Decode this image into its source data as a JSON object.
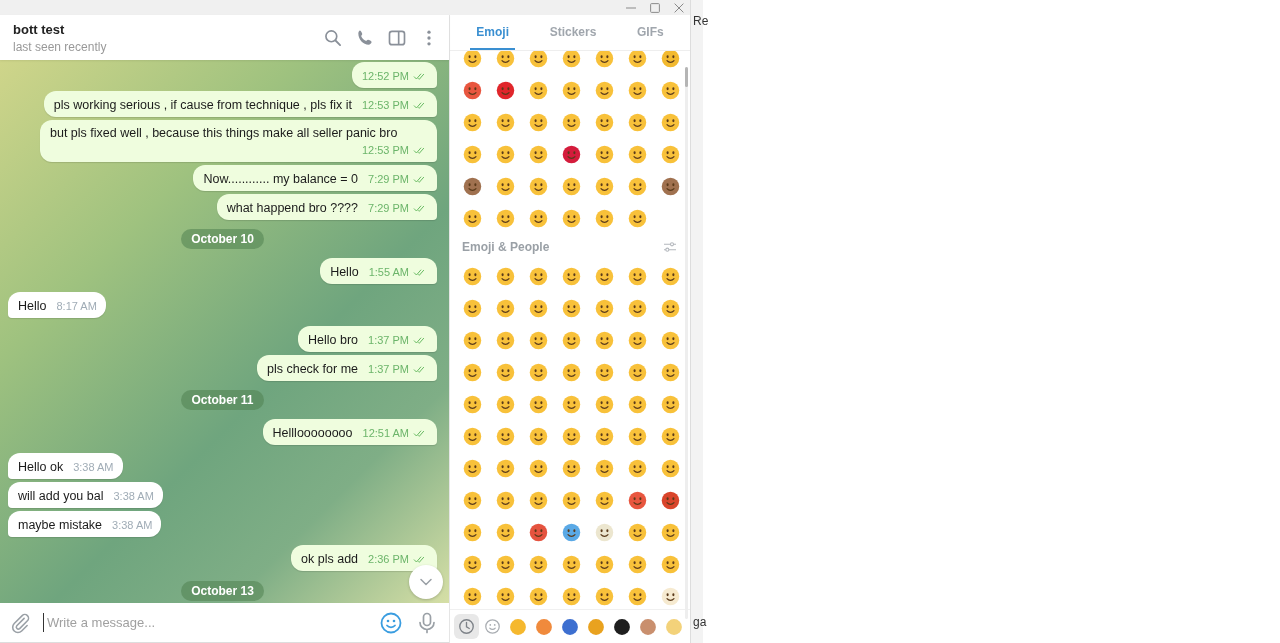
{
  "chat": {
    "title": "bott test",
    "status": "last seen recently"
  },
  "messages": [
    {
      "kind": "message",
      "outgoing": true,
      "read": true,
      "time": "12:52 PM"
    },
    {
      "kind": "message",
      "outgoing": true,
      "read": true,
      "text": "pls working serious ,  if cause from technique  , pls fix it",
      "time": "12:53 PM"
    },
    {
      "kind": "message",
      "outgoing": true,
      "read": true,
      "text": "but pls fixed well , because this things make all seller panic bro",
      "time": "12:53 PM"
    },
    {
      "kind": "message",
      "outgoing": true,
      "read": true,
      "text": "Now............ my balance = 0",
      "time": "7:29 PM"
    },
    {
      "kind": "message",
      "outgoing": true,
      "read": true,
      "text": "what happend bro ????",
      "time": "7:29 PM"
    },
    {
      "kind": "date",
      "text": "October 10"
    },
    {
      "kind": "message",
      "outgoing": true,
      "read": true,
      "text": "Hello",
      "time": "1:55 AM"
    },
    {
      "kind": "message",
      "outgoing": false,
      "text": "Hello",
      "time": "8:17 AM"
    },
    {
      "kind": "message",
      "outgoing": true,
      "read": true,
      "text": "Hello bro",
      "time": "1:37 PM"
    },
    {
      "kind": "message",
      "outgoing": true,
      "read": true,
      "text": "pls check for me",
      "time": "1:37 PM"
    },
    {
      "kind": "date",
      "text": "October 11"
    },
    {
      "kind": "message",
      "outgoing": true,
      "read": true,
      "text": "Hellloooooooo",
      "time": "12:51 AM"
    },
    {
      "kind": "message",
      "outgoing": false,
      "text": "Hello ok",
      "time": "3:38 AM"
    },
    {
      "kind": "message",
      "outgoing": false,
      "text": "will add you bal",
      "time": "3:38 AM"
    },
    {
      "kind": "message",
      "outgoing": false,
      "text": "maybe mistake",
      "time": "3:38 AM"
    },
    {
      "kind": "message",
      "outgoing": true,
      "read": true,
      "text": "ok pls add",
      "time": "2:36 PM"
    },
    {
      "kind": "date",
      "text": "October 13"
    }
  ],
  "compose": {
    "placeholder": "Write a message..."
  },
  "emoji_panel": {
    "tabs": [
      {
        "label": "Emoji",
        "selected": true
      },
      {
        "label": "Stickers",
        "selected": false
      },
      {
        "label": "GIFs",
        "selected": false
      }
    ],
    "sections": [
      {
        "emoji": [
          {
            "color": "#f8c13a"
          },
          {
            "color": "#f8c13a"
          },
          {
            "color": "#f8c13a"
          },
          {
            "color": "#f8c13a"
          },
          {
            "color": "#f8c13a"
          },
          {
            "color": "#f8c13a"
          },
          {
            "color": "#f2b92f"
          },
          {
            "color": "#e8563f"
          },
          {
            "color": "#e0262b"
          },
          {
            "color": "#f8c13a"
          },
          {
            "color": "#f8c13a"
          },
          {
            "color": "#f8c13a"
          },
          {
            "color": "#f8c13a"
          },
          {
            "color": "#f8c13a"
          },
          {
            "color": "#f8c13a"
          },
          {
            "color": "#f8c13a"
          },
          {
            "color": "#f8c13a"
          },
          {
            "color": "#f8c13a"
          },
          {
            "color": "#f8c13a"
          },
          {
            "color": "#f8c13a"
          },
          {
            "color": "#f8c13a"
          },
          {
            "color": "#f8c13a"
          },
          {
            "color": "#f8c13a"
          },
          {
            "color": "#f8c13a"
          },
          {
            "color": "#d41c3c"
          },
          {
            "color": "#f8c13a"
          },
          {
            "color": "#f8c13a"
          },
          {
            "color": "#f8c13a"
          },
          {
            "color": "#a0714f"
          },
          {
            "color": "#f8c13a"
          },
          {
            "color": "#f8c13a"
          },
          {
            "color": "#f8c13a"
          },
          {
            "color": "#f8c13a"
          },
          {
            "color": "#f8c13a"
          },
          {
            "color": "#a0714f"
          },
          {
            "color": "#f8c13a"
          },
          {
            "color": "#f8c13a"
          },
          {
            "color": "#f8c13a"
          },
          {
            "color": "#f8c13a"
          },
          {
            "color": "#f8c13a"
          },
          {
            "color": "#f8c13a"
          }
        ]
      },
      {
        "title": "Emoji & People",
        "emoji": [
          {
            "color": "#f8c13a"
          },
          {
            "color": "#f8c13a"
          },
          {
            "color": "#f8c13a"
          },
          {
            "color": "#f8c13a"
          },
          {
            "color": "#f8c13a"
          },
          {
            "color": "#f8c13a"
          },
          {
            "color": "#f8c13a"
          },
          {
            "color": "#f8c13a"
          },
          {
            "color": "#f8c13a"
          },
          {
            "color": "#f8c13a"
          },
          {
            "color": "#f8c13a"
          },
          {
            "color": "#f8c13a"
          },
          {
            "color": "#f8c13a"
          },
          {
            "color": "#f8c13a"
          },
          {
            "color": "#f8c13a"
          },
          {
            "color": "#f8c13a"
          },
          {
            "color": "#f8c13a"
          },
          {
            "color": "#f8c13a"
          },
          {
            "color": "#f8c13a"
          },
          {
            "color": "#f8c13a"
          },
          {
            "color": "#f8c13a"
          },
          {
            "color": "#f8c13a"
          },
          {
            "color": "#f8c13a"
          },
          {
            "color": "#f8c13a"
          },
          {
            "color": "#f8c13a"
          },
          {
            "color": "#f8c13a"
          },
          {
            "color": "#f8c13a"
          },
          {
            "color": "#f8c13a"
          },
          {
            "color": "#f8c13a"
          },
          {
            "color": "#f8c13a"
          },
          {
            "color": "#f8c13a"
          },
          {
            "color": "#f8c13a"
          },
          {
            "color": "#f8c13a"
          },
          {
            "color": "#f8c13a"
          },
          {
            "color": "#f8c13a"
          },
          {
            "color": "#f8c13a"
          },
          {
            "color": "#f8c13a"
          },
          {
            "color": "#f8c13a"
          },
          {
            "color": "#f8c13a"
          },
          {
            "color": "#f8c13a"
          },
          {
            "color": "#f8c13a"
          },
          {
            "color": "#f8c13a"
          },
          {
            "color": "#f8c13a"
          },
          {
            "color": "#f8c13a"
          },
          {
            "color": "#f8c13a"
          },
          {
            "color": "#f8c13a"
          },
          {
            "color": "#f8c13a"
          },
          {
            "color": "#f8c13a"
          },
          {
            "color": "#f8c13a"
          },
          {
            "color": "#f8c13a"
          },
          {
            "color": "#f8c13a"
          },
          {
            "color": "#f8c13a"
          },
          {
            "color": "#f8c13a"
          },
          {
            "color": "#f8c13a"
          },
          {
            "color": "#e8563f"
          },
          {
            "color": "#d9452b"
          },
          {
            "color": "#f8c13a"
          },
          {
            "color": "#f8c13a"
          },
          {
            "color": "#e5533f"
          },
          {
            "color": "#5aa9e6"
          },
          {
            "color": "#ece6cf"
          },
          {
            "color": "#f8c13a"
          },
          {
            "color": "#f8c13a"
          },
          {
            "color": "#f8c13a"
          },
          {
            "color": "#f8c13a"
          },
          {
            "color": "#f8c13a"
          },
          {
            "color": "#f8c13a"
          },
          {
            "color": "#f8c13a"
          },
          {
            "color": "#f8c13a"
          },
          {
            "color": "#f8c13a"
          },
          {
            "color": "#f8c13a"
          },
          {
            "color": "#f8c13a"
          },
          {
            "color": "#f8c13a"
          },
          {
            "color": "#f8c13a"
          },
          {
            "color": "#f8c13a"
          },
          {
            "color": "#f8c13a"
          },
          {
            "color": "#f6ead0"
          }
        ]
      }
    ],
    "category_tabs": [
      {
        "kind": "recent",
        "selected": true
      },
      {
        "kind": "emoji",
        "selected": false
      },
      {
        "kind": "pack",
        "selected": false,
        "color": "#f5b82e"
      },
      {
        "kind": "pack",
        "selected": false,
        "color": "#f08a3c"
      },
      {
        "kind": "pack",
        "selected": false,
        "color": "#3d6fd0"
      },
      {
        "kind": "pack",
        "selected": false,
        "color": "#e9a21f"
      },
      {
        "kind": "pack",
        "selected": false,
        "color": "#1e1e1e"
      },
      {
        "kind": "pack",
        "selected": false,
        "color": "#c98f6e"
      },
      {
        "kind": "pack",
        "selected": false,
        "color": "#f3d27a"
      }
    ]
  },
  "background_window": {
    "texts": [
      "Re",
      "ga"
    ]
  }
}
